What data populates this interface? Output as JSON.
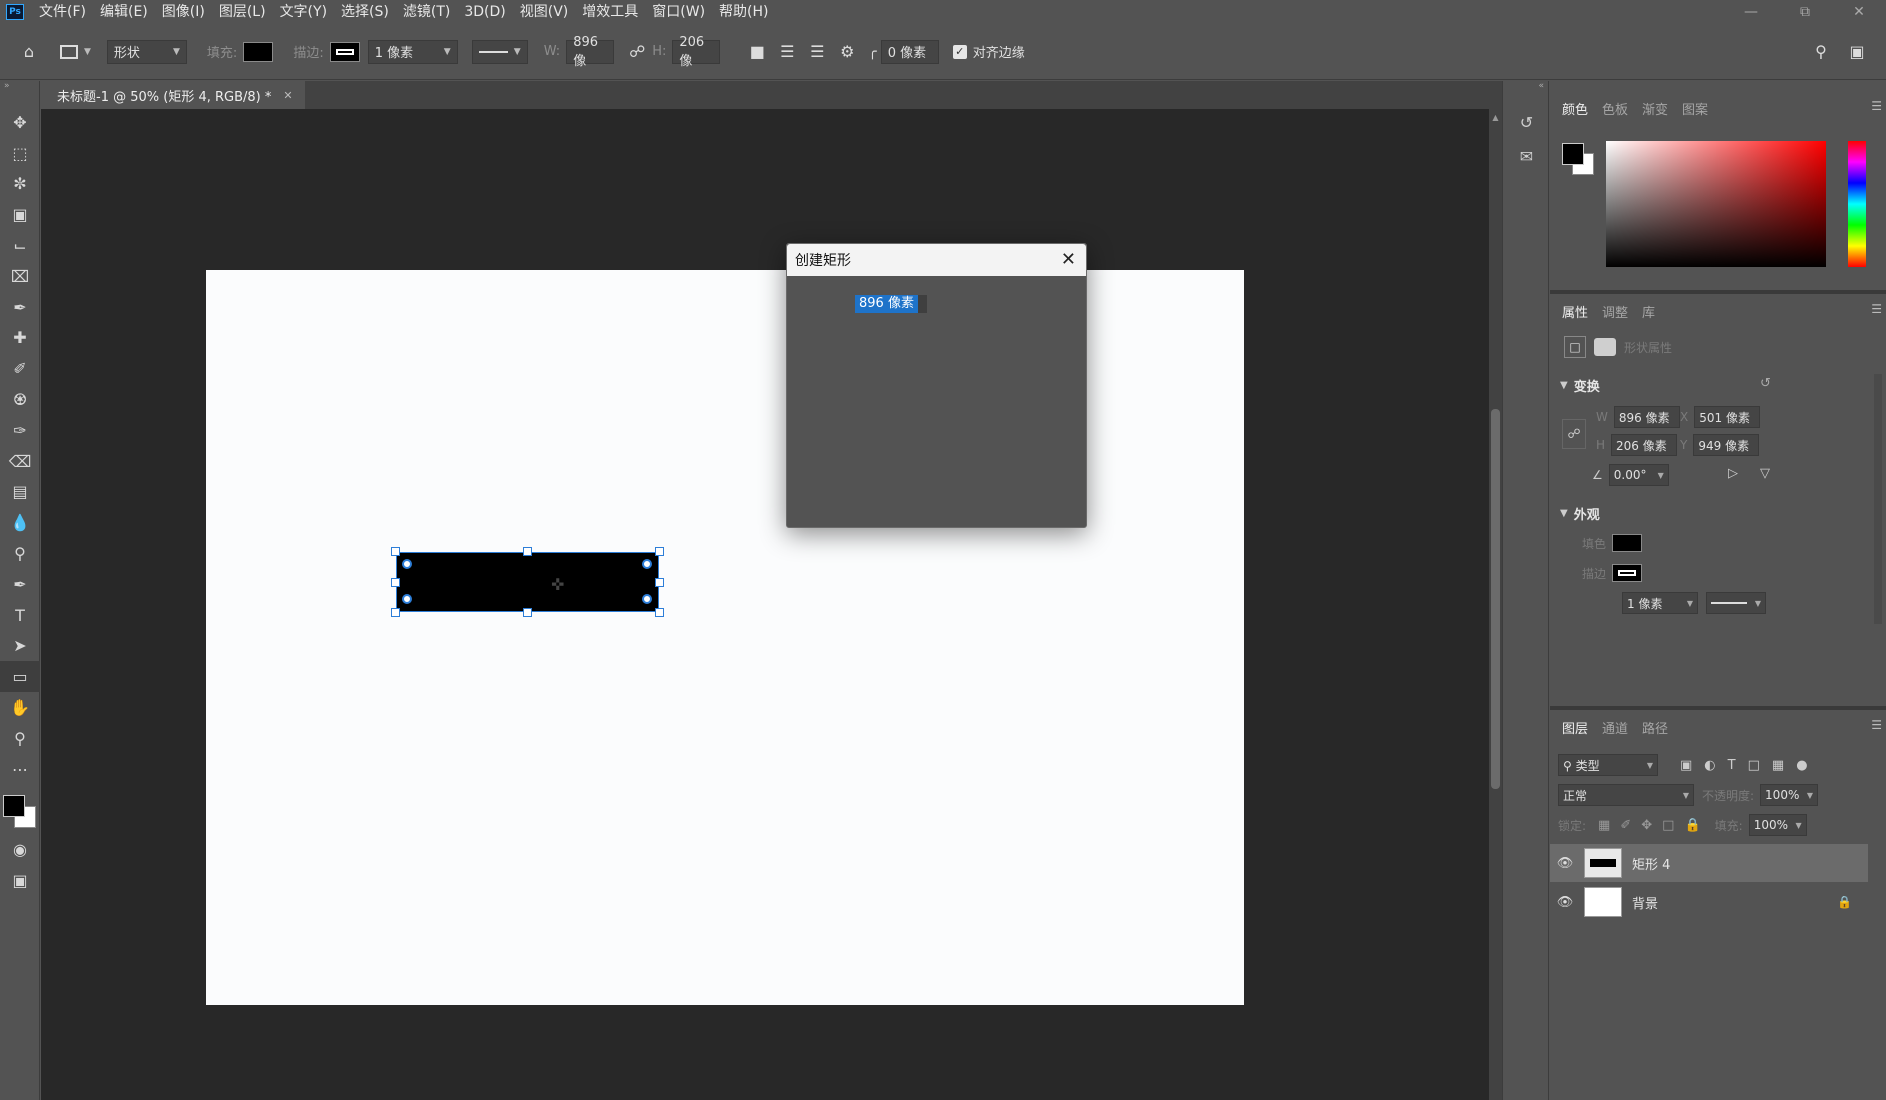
{
  "app": {
    "logo": "Ps",
    "menu": [
      "文件(F)",
      "编辑(E)",
      "图像(I)",
      "图层(L)",
      "文字(Y)",
      "选择(S)",
      "滤镜(T)",
      "3D(D)",
      "视图(V)",
      "增效工具",
      "窗口(W)",
      "帮助(H)"
    ]
  },
  "options": {
    "mode": "形状",
    "fill_label": "填充:",
    "stroke_label": "描边:",
    "stroke_width": "1 像素",
    "w_label": "W:",
    "w_value": "896 像",
    "h_label": "H:",
    "h_value": "206 像",
    "radius": "0 像素",
    "align_edges": "对齐边缘"
  },
  "document": {
    "tab_title": "未标题-1 @ 50% (矩形 4, RGB/8) *"
  },
  "dialog": {
    "title": "创建矩形",
    "value": "896 像素"
  },
  "color_panel": {
    "tabs": [
      "颜色",
      "色板",
      "渐变",
      "图案"
    ]
  },
  "properties_panel": {
    "tabs": [
      "属性",
      "调整",
      "库"
    ],
    "subtitle": "形状属性",
    "transform_title": "变换",
    "w_label": "W",
    "w": "896 像素",
    "x_label": "X",
    "x": "501 像素",
    "h_label": "H",
    "h": "206 像素",
    "y_label": "Y",
    "y": "949 像素",
    "angle": "0.00°",
    "appearance_title": "外观",
    "fill_label": "填色",
    "stroke_label": "描边",
    "stroke_width": "1 像素"
  },
  "layers_panel": {
    "tabs": [
      "图层",
      "通道",
      "路径"
    ],
    "filter": "类型",
    "blend_mode": "正常",
    "opacity_label": "不透明度:",
    "opacity": "100%",
    "lock_label": "锁定:",
    "fill_label": "填充:",
    "fill": "100%",
    "layers": [
      {
        "name": "矩形 4",
        "selected": true
      },
      {
        "name": "背景",
        "selected": false
      }
    ]
  }
}
